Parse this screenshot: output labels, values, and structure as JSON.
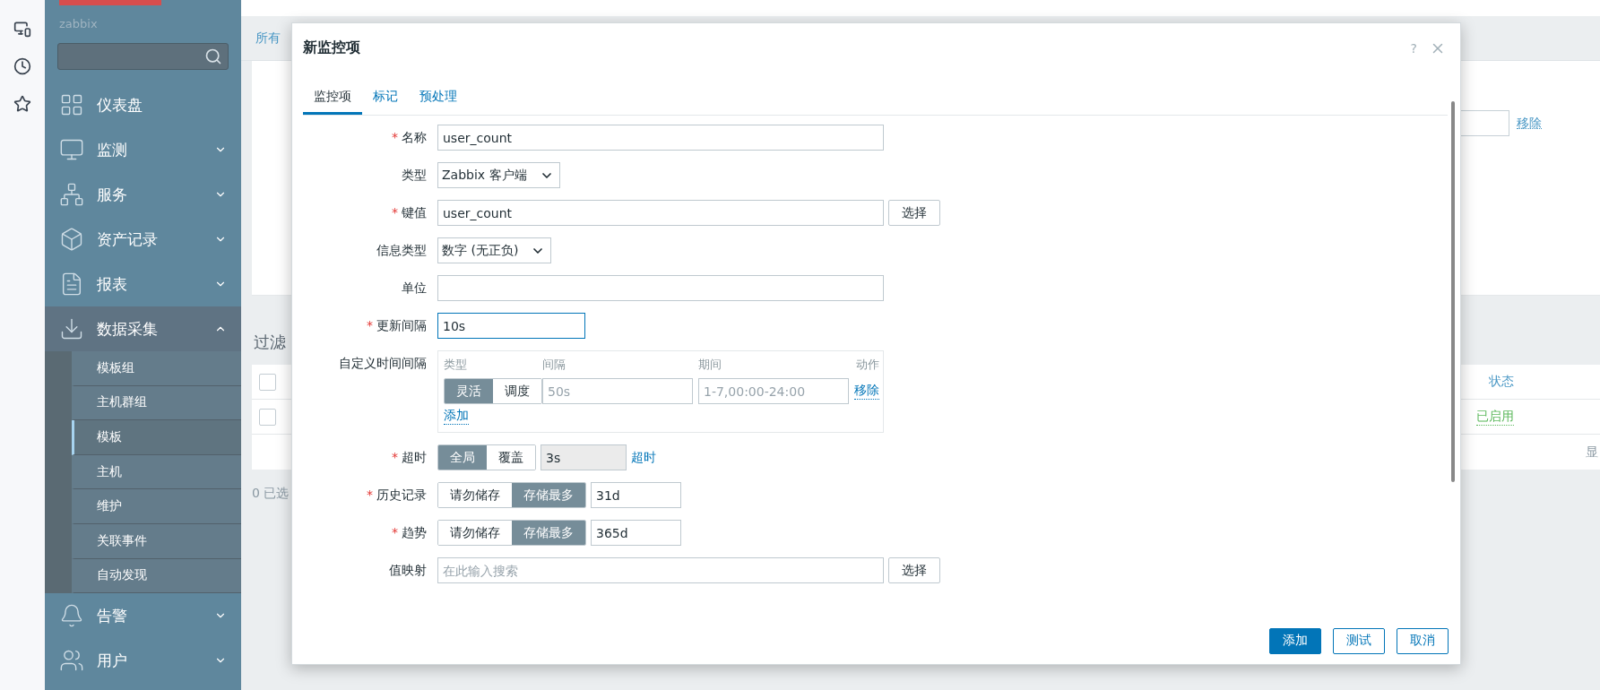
{
  "sidebar": {
    "brand": "zabbix",
    "nav": [
      {
        "label": "仪表盘",
        "kind": "link"
      },
      {
        "label": "监测",
        "kind": "menu",
        "expanded": false
      },
      {
        "label": "服务",
        "kind": "menu",
        "expanded": false
      },
      {
        "label": "资产记录",
        "kind": "menu",
        "expanded": false
      },
      {
        "label": "报表",
        "kind": "menu",
        "expanded": false
      },
      {
        "label": "数据采集",
        "kind": "menu",
        "expanded": true,
        "children": [
          {
            "label": "模板组",
            "selected": false
          },
          {
            "label": "主机群组",
            "selected": false
          },
          {
            "label": "模板",
            "selected": true
          },
          {
            "label": "主机",
            "selected": false
          },
          {
            "label": "维护",
            "selected": false
          },
          {
            "label": "关联事件",
            "selected": false
          },
          {
            "label": "自动发现",
            "selected": false
          }
        ]
      },
      {
        "label": "告警",
        "kind": "menu",
        "expanded": false
      },
      {
        "label": "用户",
        "kind": "menu",
        "expanded": false
      }
    ]
  },
  "background": {
    "tab_link": "所有",
    "remove_link": "移除",
    "filter_title": "过滤",
    "table": {
      "header": "状态",
      "header_checked": false,
      "rows": [
        {
          "status": "已启用",
          "checked": false
        }
      ],
      "pager": "显"
    },
    "selected_count": "0 已选"
  },
  "dialog": {
    "title": "新监控项",
    "help": "?",
    "required_mark": "*",
    "tabs": [
      {
        "label": "监控项",
        "selected": true
      },
      {
        "label": "标记",
        "selected": false
      },
      {
        "label": "预处理",
        "selected": false
      }
    ],
    "fields": [
      {
        "kind": "text",
        "label": "名称",
        "required": true,
        "value": "user_count"
      },
      {
        "kind": "select",
        "label": "类型",
        "required": false,
        "value": "Zabbix 客户端"
      },
      {
        "kind": "text_button",
        "label": "键值",
        "required": true,
        "value": "user_count",
        "button": "选择"
      },
      {
        "kind": "select",
        "label": "信息类型",
        "required": false,
        "value": "数字 (无正负)"
      },
      {
        "kind": "text",
        "label": "单位",
        "required": false
      },
      {
        "kind": "short",
        "label": "更新间隔",
        "required": true,
        "value": "10s"
      },
      {
        "kind": "intervals",
        "label": "自定义时间间隔",
        "required": false,
        "columns": [
          "类型",
          "间隔",
          "期间",
          "动作"
        ],
        "rows": [
          {
            "modes": [
              {
                "label": "灵活",
                "selected": true
              },
              {
                "label": "调度",
                "selected": false
              }
            ],
            "interval_placeholder": "50s",
            "period_placeholder": "1-7,00:00-24:00",
            "action": "移除"
          }
        ],
        "add_link": "添加"
      },
      {
        "kind": "segmented",
        "label": "超时",
        "required": true,
        "options": [
          {
            "label": "全局",
            "selected": true
          },
          {
            "label": "覆盖",
            "selected": false
          }
        ],
        "value": "3s",
        "disabled": true,
        "link": "超时"
      },
      {
        "kind": "segmented",
        "label": "历史记录",
        "required": true,
        "options": [
          {
            "label": "请勿储存",
            "selected": false
          },
          {
            "label": "存储最多",
            "selected": true
          }
        ],
        "value": "31d",
        "disabled": false
      },
      {
        "kind": "segmented",
        "label": "趋势",
        "required": true,
        "options": [
          {
            "label": "请勿储存",
            "selected": false
          },
          {
            "label": "存储最多",
            "selected": true
          }
        ],
        "value": "365d",
        "disabled": false
      },
      {
        "kind": "search_button",
        "label": "值映射",
        "required": false,
        "placeholder": "在此输入搜索",
        "button": "选择"
      }
    ],
    "buttons": [
      {
        "label": "添加",
        "kind": "primary"
      },
      {
        "label": "测试",
        "kind": "secondary"
      },
      {
        "label": "取消",
        "kind": "secondary"
      }
    ]
  }
}
